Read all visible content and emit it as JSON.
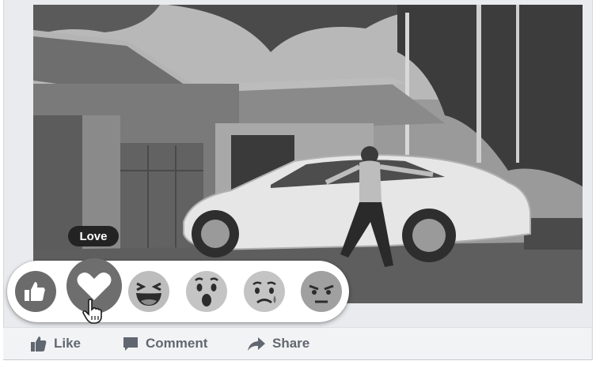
{
  "post": {
    "photo_description_icon": "car-photo",
    "actions": [
      {
        "label": "Like",
        "icon": "thumbs-up-icon"
      },
      {
        "label": "Comment",
        "icon": "comment-icon"
      },
      {
        "label": "Share",
        "icon": "share-arrow-icon"
      }
    ]
  },
  "reactions": {
    "tooltip_label": "Love",
    "items": [
      {
        "name": "like",
        "icon": "thumbs-up-reaction-icon"
      },
      {
        "name": "love",
        "icon": "heart-reaction-icon"
      },
      {
        "name": "haha",
        "icon": "laughing-face-icon"
      },
      {
        "name": "wow",
        "icon": "surprised-face-icon"
      },
      {
        "name": "sad",
        "icon": "crying-face-icon"
      },
      {
        "name": "angry",
        "icon": "angry-face-icon"
      }
    ],
    "hovered": "love"
  },
  "colors": {
    "card_bg": "#e9ebee",
    "action_text": "#616770",
    "tooltip_bg": "#232323"
  }
}
